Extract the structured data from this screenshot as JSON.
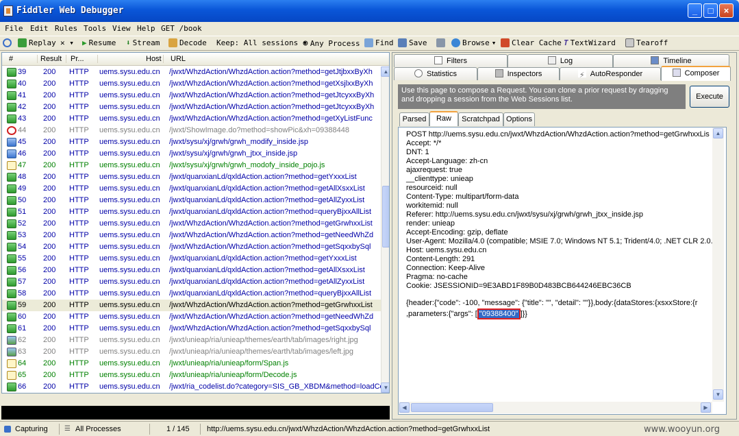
{
  "window": {
    "title": "Fiddler Web Debugger",
    "minimize": "_",
    "maximize": "□",
    "close": "×"
  },
  "menu": [
    "File",
    "Edit",
    "Rules",
    "Tools",
    "View",
    "Help",
    "GET /book"
  ],
  "toolbar": {
    "replay": "Replay",
    "remove": "✕ ▾",
    "resume": "Resume",
    "stream": "Stream",
    "decode": "Decode",
    "keep": "Keep: All sessions ▾",
    "process": "Any Process",
    "find": "Find",
    "save": "Save",
    "browse": "Browse",
    "clear_cache": "Clear Cache",
    "textwizard": "TextWizard",
    "tearoff": "Tearoff"
  },
  "sessions": {
    "columns": [
      "#",
      "Result",
      "Pr...",
      "Host",
      "URL"
    ],
    "rows": [
      {
        "id": "39",
        "result": "200",
        "protocol": "HTTP",
        "host": "uems.sysu.edu.cn",
        "url": "/jwxt/WhzdAction/WhzdAction.action?method=getJtjbxxByXh",
        "icon": "arrow-icon",
        "color": "#0000a8"
      },
      {
        "id": "40",
        "result": "200",
        "protocol": "HTTP",
        "host": "uems.sysu.edu.cn",
        "url": "/jwxt/WhzdAction/WhzdAction.action?method=getXsjlxxByXh",
        "icon": "arrow-icon",
        "color": "#0000a8"
      },
      {
        "id": "41",
        "result": "200",
        "protocol": "HTTP",
        "host": "uems.sysu.edu.cn",
        "url": "/jwxt/WhzdAction/WhzdAction.action?method=getJtcyxxByXh",
        "icon": "arrow-icon",
        "color": "#0000a8"
      },
      {
        "id": "42",
        "result": "200",
        "protocol": "HTTP",
        "host": "uems.sysu.edu.cn",
        "url": "/jwxt/WhzdAction/WhzdAction.action?method=getJtcyxxByXh",
        "icon": "arrow-icon",
        "color": "#0000a8"
      },
      {
        "id": "43",
        "result": "200",
        "protocol": "HTTP",
        "host": "uems.sysu.edu.cn",
        "url": "/jwxt/WhzdAction/WhzdAction.action?method=getXyListFunc",
        "icon": "arrow-icon",
        "color": "#0000a8"
      },
      {
        "id": "44",
        "result": "200",
        "protocol": "HTTP",
        "host": "uems.sysu.edu.cn",
        "url": "/jwxt/ShowImage.do?method=showPic&xh=09388448",
        "icon": "blocked-icon",
        "color": "#808080"
      },
      {
        "id": "45",
        "result": "200",
        "protocol": "HTTP",
        "host": "uems.sysu.edu.cn",
        "url": "/jwxt/sysu/xj/grwh/grwh_modify_inside.jsp",
        "icon": "html-icon",
        "color": "#0000a8"
      },
      {
        "id": "46",
        "result": "200",
        "protocol": "HTTP",
        "host": "uems.sysu.edu.cn",
        "url": "/jwxt/sysu/xj/grwh/grwh_jtxx_inside.jsp",
        "icon": "html-icon",
        "color": "#0000a8"
      },
      {
        "id": "47",
        "result": "200",
        "protocol": "HTTP",
        "host": "uems.sysu.edu.cn",
        "url": "/jwxt/sysu/xj/grwh/grwh_modofy_inside_pojo.js",
        "icon": "js-icon",
        "color": "#008000"
      },
      {
        "id": "48",
        "result": "200",
        "protocol": "HTTP",
        "host": "uems.sysu.edu.cn",
        "url": "/jwxt/quanxianLd/qxldAction.action?method=getYxxxList",
        "icon": "arrow-icon",
        "color": "#0000a8"
      },
      {
        "id": "49",
        "result": "200",
        "protocol": "HTTP",
        "host": "uems.sysu.edu.cn",
        "url": "/jwxt/quanxianLd/qxldAction.action?method=getAllXsxxList",
        "icon": "arrow-icon",
        "color": "#0000a8"
      },
      {
        "id": "50",
        "result": "200",
        "protocol": "HTTP",
        "host": "uems.sysu.edu.cn",
        "url": "/jwxt/quanxianLd/qxldAction.action?method=getAllZyxxList",
        "icon": "arrow-icon",
        "color": "#0000a8"
      },
      {
        "id": "51",
        "result": "200",
        "protocol": "HTTP",
        "host": "uems.sysu.edu.cn",
        "url": "/jwxt/quanxianLd/qxldAction.action?method=queryBjxxAllList",
        "icon": "arrow-icon",
        "color": "#0000a8"
      },
      {
        "id": "52",
        "result": "200",
        "protocol": "HTTP",
        "host": "uems.sysu.edu.cn",
        "url": "/jwxt/WhzdAction/WhzdAction.action?method=getGrwhxxList",
        "icon": "arrow-icon",
        "color": "#0000a8"
      },
      {
        "id": "53",
        "result": "200",
        "protocol": "HTTP",
        "host": "uems.sysu.edu.cn",
        "url": "/jwxt/WhzdAction/WhzdAction.action?method=getNeedWhZd",
        "icon": "arrow-icon",
        "color": "#0000a8"
      },
      {
        "id": "54",
        "result": "200",
        "protocol": "HTTP",
        "host": "uems.sysu.edu.cn",
        "url": "/jwxt/WhzdAction/WhzdAction.action?method=getSqxxbySql",
        "icon": "arrow-icon",
        "color": "#0000a8"
      },
      {
        "id": "55",
        "result": "200",
        "protocol": "HTTP",
        "host": "uems.sysu.edu.cn",
        "url": "/jwxt/quanxianLd/qxldAction.action?method=getYxxxList",
        "icon": "arrow-icon",
        "color": "#0000a8"
      },
      {
        "id": "56",
        "result": "200",
        "protocol": "HTTP",
        "host": "uems.sysu.edu.cn",
        "url": "/jwxt/quanxianLd/qxldAction.action?method=getAllXsxxList",
        "icon": "arrow-icon",
        "color": "#0000a8"
      },
      {
        "id": "57",
        "result": "200",
        "protocol": "HTTP",
        "host": "uems.sysu.edu.cn",
        "url": "/jwxt/quanxianLd/qxldAction.action?method=getAllZyxxList",
        "icon": "arrow-icon",
        "color": "#0000a8"
      },
      {
        "id": "58",
        "result": "200",
        "protocol": "HTTP",
        "host": "uems.sysu.edu.cn",
        "url": "/jwxt/quanxianLd/qxldAction.action?method=queryBjxxAllList",
        "icon": "arrow-icon",
        "color": "#0000a8"
      },
      {
        "id": "59",
        "result": "200",
        "protocol": "HTTP",
        "host": "uems.sysu.edu.cn",
        "url": "/jwxt/WhzdAction/WhzdAction.action?method=getGrwhxxList",
        "icon": "arrow-icon",
        "color": "#000000",
        "selected": true
      },
      {
        "id": "60",
        "result": "200",
        "protocol": "HTTP",
        "host": "uems.sysu.edu.cn",
        "url": "/jwxt/WhzdAction/WhzdAction.action?method=getNeedWhZd",
        "icon": "arrow-icon",
        "color": "#0000a8"
      },
      {
        "id": "61",
        "result": "200",
        "protocol": "HTTP",
        "host": "uems.sysu.edu.cn",
        "url": "/jwxt/WhzdAction/WhzdAction.action?method=getSqxxbySql",
        "icon": "arrow-icon",
        "color": "#0000a8"
      },
      {
        "id": "62",
        "result": "200",
        "protocol": "HTTP",
        "host": "uems.sysu.edu.cn",
        "url": "/jwxt/unieap/ria/unieap/themes/earth/tab/images/right.jpg",
        "icon": "image-icon",
        "color": "#808080"
      },
      {
        "id": "63",
        "result": "200",
        "protocol": "HTTP",
        "host": "uems.sysu.edu.cn",
        "url": "/jwxt/unieap/ria/unieap/themes/earth/tab/images/left.jpg",
        "icon": "image-icon",
        "color": "#808080"
      },
      {
        "id": "64",
        "result": "200",
        "protocol": "HTTP",
        "host": "uems.sysu.edu.cn",
        "url": "/jwxt/unieap/ria/unieap/form/Span.js",
        "icon": "js-icon",
        "color": "#008000"
      },
      {
        "id": "65",
        "result": "200",
        "protocol": "HTTP",
        "host": "uems.sysu.edu.cn",
        "url": "/jwxt/unieap/ria/unieap/form/Decode.js",
        "icon": "js-icon",
        "color": "#008000"
      },
      {
        "id": "66",
        "result": "200",
        "protocol": "HTTP",
        "host": "uems.sysu.edu.cn",
        "url": "/jwxt/ria_codelist.do?category=SIS_GB_XBDM&method=loadCo",
        "icon": "arrow-icon",
        "color": "#0000a8"
      }
    ]
  },
  "right_tabs": {
    "row1": [
      "Filters",
      "Log",
      "Timeline"
    ],
    "row2": [
      "Statistics",
      "Inspectors",
      "AutoResponder",
      "Composer"
    ]
  },
  "composer": {
    "info": "Use this page to compose a Request. You can clone a prior request by dragging and dropping a session from the Web Sessions list.",
    "execute": "Execute",
    "subtabs": [
      "Parsed",
      "Raw",
      "Scratchpad",
      "Options"
    ],
    "raw_lines": [
      "POST http://uems.sysu.edu.cn/jwxt/WhzdAction/WhzdAction.action?method=getGrwhxxLis",
      "Accept: */*",
      "DNT: 1",
      "Accept-Language: zh-cn",
      "ajaxrequest: true",
      "__clienttype: unieap",
      "resourceid: null",
      "Content-Type: multipart/form-data",
      "workitemid: null",
      "Referer: http://uems.sysu.edu.cn/jwxt/sysu/xj/grwh/grwh_jtxx_inside.jsp",
      "render: unieap",
      "Accept-Encoding: gzip, deflate",
      "User-Agent: Mozilla/4.0 (compatible; MSIE 7.0; Windows NT 5.1; Trident/4.0; .NET CLR 2.0.5",
      "Host: uems.sysu.edu.cn",
      "Content-Length: 291",
      "Connection: Keep-Alive",
      "Pragma: no-cache",
      "Cookie: JSESSIONID=9E3ABD1F89B0D483BCB644246EBC36CB"
    ],
    "body_line1": "{header:{\"code\": -100, \"message\": {\"title\": \"\", \"detail\": \"\"}},body:{dataStores:{xsxxStore:{r",
    "body_line2_pre": ",parameters:{\"args\": [",
    "body_line2_hl": "\"09388400\"",
    "body_line2_post": "]}}"
  },
  "status": {
    "capturing": "Capturing",
    "processes": "All Processes",
    "count": "1 / 145",
    "url": "http://uems.sysu.edu.cn/jwxt/WhzdAction/WhzdAction.action?method=getGrwhxxList"
  },
  "watermark": "www.wooyun.org",
  "colors": {
    "title_bar": "#0a56d8",
    "selected_row": "#ecebd8",
    "highlight_border": "#e02020"
  }
}
